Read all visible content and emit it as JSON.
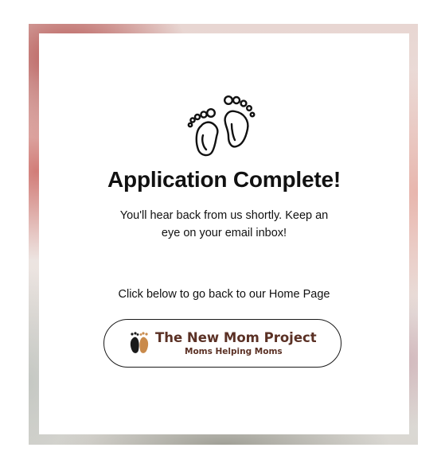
{
  "page": {
    "title": "Application Complete!",
    "message": "You'll hear back from us shortly. Keep an eye on your email inbox!",
    "cta_text": "Click below to go back to our Home Page"
  },
  "home_button": {
    "logo_title": "The New Mom Project",
    "logo_tagline": "Moms Helping Moms"
  },
  "colors": {
    "brand_brown": "#5b3125",
    "text": "#111111",
    "button_border": "#1a1a1a"
  },
  "icons": {
    "hero": "baby-feet-icon",
    "logo": "baby-feet-logo-icon"
  }
}
